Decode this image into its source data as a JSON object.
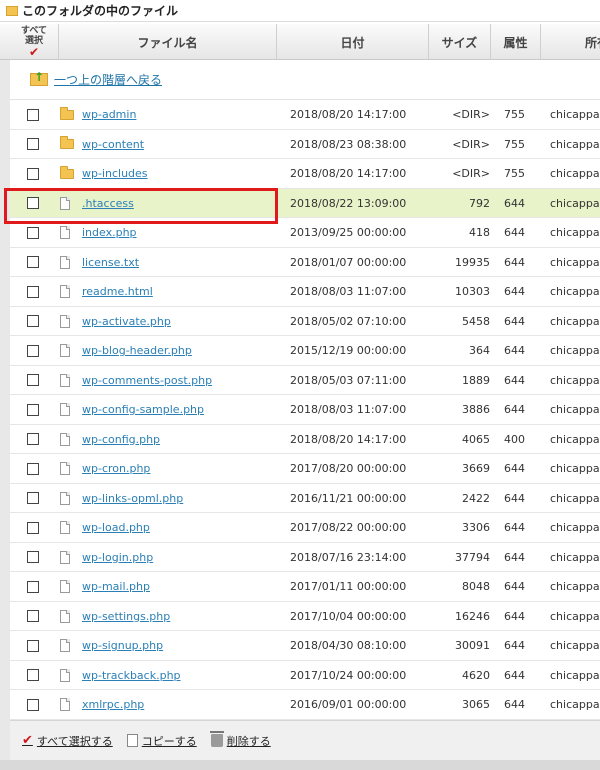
{
  "title": "このフォルダの中のファイル",
  "header": {
    "select_all_line1": "すべて",
    "select_all_line2": "選択",
    "name": "ファイル名",
    "date": "日付",
    "size": "サイズ",
    "perm": "属性",
    "owner": "所有"
  },
  "up_link": "一つ上の階層へ戻る",
  "rows": [
    {
      "name": "wp-admin",
      "type": "folder",
      "date": "2018/08/20 14:17:00",
      "size": "<DIR>",
      "perm": "755",
      "owner": "chicappa"
    },
    {
      "name": "wp-content",
      "type": "folder",
      "date": "2018/08/23 08:38:00",
      "size": "<DIR>",
      "perm": "755",
      "owner": "chicappa"
    },
    {
      "name": "wp-includes",
      "type": "folder",
      "date": "2018/08/20 14:17:00",
      "size": "<DIR>",
      "perm": "755",
      "owner": "chicappa"
    },
    {
      "name": ".htaccess",
      "type": "file",
      "date": "2018/08/22 13:09:00",
      "size": "792",
      "perm": "644",
      "owner": "chicappa",
      "highlight": true
    },
    {
      "name": "index.php",
      "type": "file",
      "date": "2013/09/25 00:00:00",
      "size": "418",
      "perm": "644",
      "owner": "chicappa"
    },
    {
      "name": "license.txt",
      "type": "file",
      "date": "2018/01/07 00:00:00",
      "size": "19935",
      "perm": "644",
      "owner": "chicappa"
    },
    {
      "name": "readme.html",
      "type": "file",
      "date": "2018/08/03 11:07:00",
      "size": "10303",
      "perm": "644",
      "owner": "chicappa"
    },
    {
      "name": "wp-activate.php",
      "type": "file",
      "date": "2018/05/02 07:10:00",
      "size": "5458",
      "perm": "644",
      "owner": "chicappa"
    },
    {
      "name": "wp-blog-header.php",
      "type": "file",
      "date": "2015/12/19 00:00:00",
      "size": "364",
      "perm": "644",
      "owner": "chicappa"
    },
    {
      "name": "wp-comments-post.php",
      "type": "file",
      "date": "2018/05/03 07:11:00",
      "size": "1889",
      "perm": "644",
      "owner": "chicappa"
    },
    {
      "name": "wp-config-sample.php",
      "type": "file",
      "date": "2018/08/03 11:07:00",
      "size": "3886",
      "perm": "644",
      "owner": "chicappa"
    },
    {
      "name": "wp-config.php",
      "type": "file",
      "date": "2018/08/20 14:17:00",
      "size": "4065",
      "perm": "400",
      "owner": "chicappa"
    },
    {
      "name": "wp-cron.php",
      "type": "file",
      "date": "2017/08/20 00:00:00",
      "size": "3669",
      "perm": "644",
      "owner": "chicappa"
    },
    {
      "name": "wp-links-opml.php",
      "type": "file",
      "date": "2016/11/21 00:00:00",
      "size": "2422",
      "perm": "644",
      "owner": "chicappa"
    },
    {
      "name": "wp-load.php",
      "type": "file",
      "date": "2017/08/22 00:00:00",
      "size": "3306",
      "perm": "644",
      "owner": "chicappa"
    },
    {
      "name": "wp-login.php",
      "type": "file",
      "date": "2018/07/16 23:14:00",
      "size": "37794",
      "perm": "644",
      "owner": "chicappa"
    },
    {
      "name": "wp-mail.php",
      "type": "file",
      "date": "2017/01/11 00:00:00",
      "size": "8048",
      "perm": "644",
      "owner": "chicappa"
    },
    {
      "name": "wp-settings.php",
      "type": "file",
      "date": "2017/10/04 00:00:00",
      "size": "16246",
      "perm": "644",
      "owner": "chicappa"
    },
    {
      "name": "wp-signup.php",
      "type": "file",
      "date": "2018/04/30 08:10:00",
      "size": "30091",
      "perm": "644",
      "owner": "chicappa"
    },
    {
      "name": "wp-trackback.php",
      "type": "file",
      "date": "2017/10/24 00:00:00",
      "size": "4620",
      "perm": "644",
      "owner": "chicappa"
    },
    {
      "name": "xmlrpc.php",
      "type": "file",
      "date": "2016/09/01 00:00:00",
      "size": "3065",
      "perm": "644",
      "owner": "chicappa"
    }
  ],
  "footer": {
    "select_all": "すべて選択する",
    "copy": "コピーする",
    "delete": "削除する"
  },
  "colors": {
    "highlight_row": "#e8f3c9",
    "annotation_box": "#e01a1a",
    "link": "#2a7fb6"
  }
}
